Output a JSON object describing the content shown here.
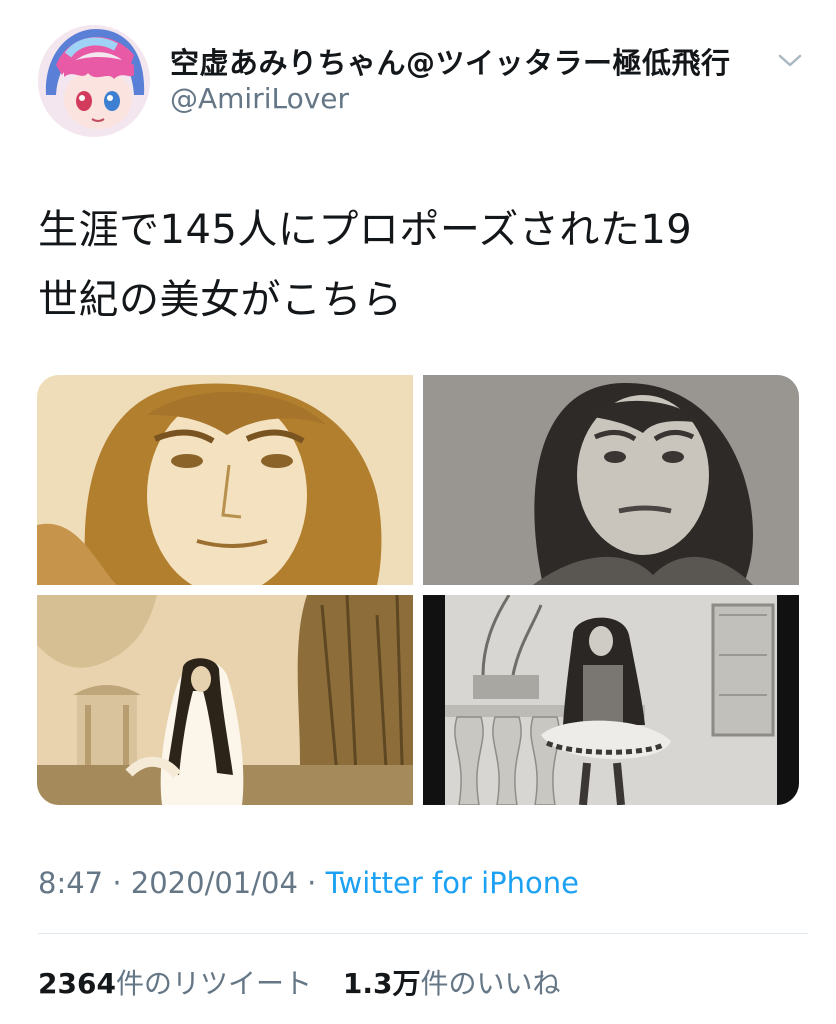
{
  "tweet": {
    "author": {
      "display_name": "空虚あみりちゃん@ツイッタラー極低飛行",
      "handle": "@AmiriLover"
    },
    "text_lines": [
      "生涯で145人にプロポーズされた19",
      "世紀の美女がこちら"
    ],
    "timestamp": "8:47 · 2020/01/04 · ",
    "source": "Twitter for iPhone",
    "stats": {
      "retweets_count": "2364",
      "retweets_label": "件のリツイート",
      "likes_count": "1.3万",
      "likes_label": "件のいいね"
    }
  },
  "icons": {
    "more_menu": "chevron-down-icon"
  },
  "colors": {
    "link": "#1da1f2",
    "secondary_text": "#657786",
    "primary_text": "#14171a",
    "divider": "#e1e8ed"
  }
}
